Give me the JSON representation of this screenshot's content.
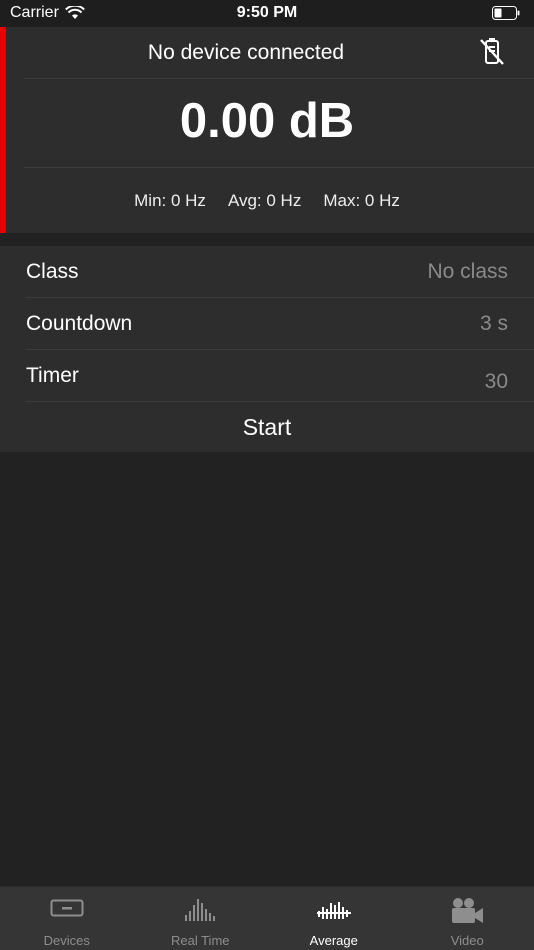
{
  "status_bar": {
    "carrier": "Carrier",
    "time": "9:50 PM"
  },
  "device": {
    "title": "No device connected",
    "db_value": "0.00 dB",
    "min": "Min: 0 Hz",
    "avg": "Avg: 0 Hz",
    "max": "Max: 0 Hz",
    "accent_color": "#e60000",
    "status_icon": "no-device-icon"
  },
  "settings": {
    "class_label": "Class",
    "class_value": "No class",
    "countdown_label": "Countdown",
    "countdown_value": "3 s",
    "timer_label": "Timer",
    "timer_value": "30",
    "start_label": "Start"
  },
  "tabs": [
    {
      "label": "Devices",
      "icon": "devices-icon",
      "active": false
    },
    {
      "label": "Real Time",
      "icon": "real-time-icon",
      "active": false
    },
    {
      "label": "Average",
      "icon": "average-icon",
      "active": true
    },
    {
      "label": "Video",
      "icon": "video-icon",
      "active": false
    }
  ]
}
